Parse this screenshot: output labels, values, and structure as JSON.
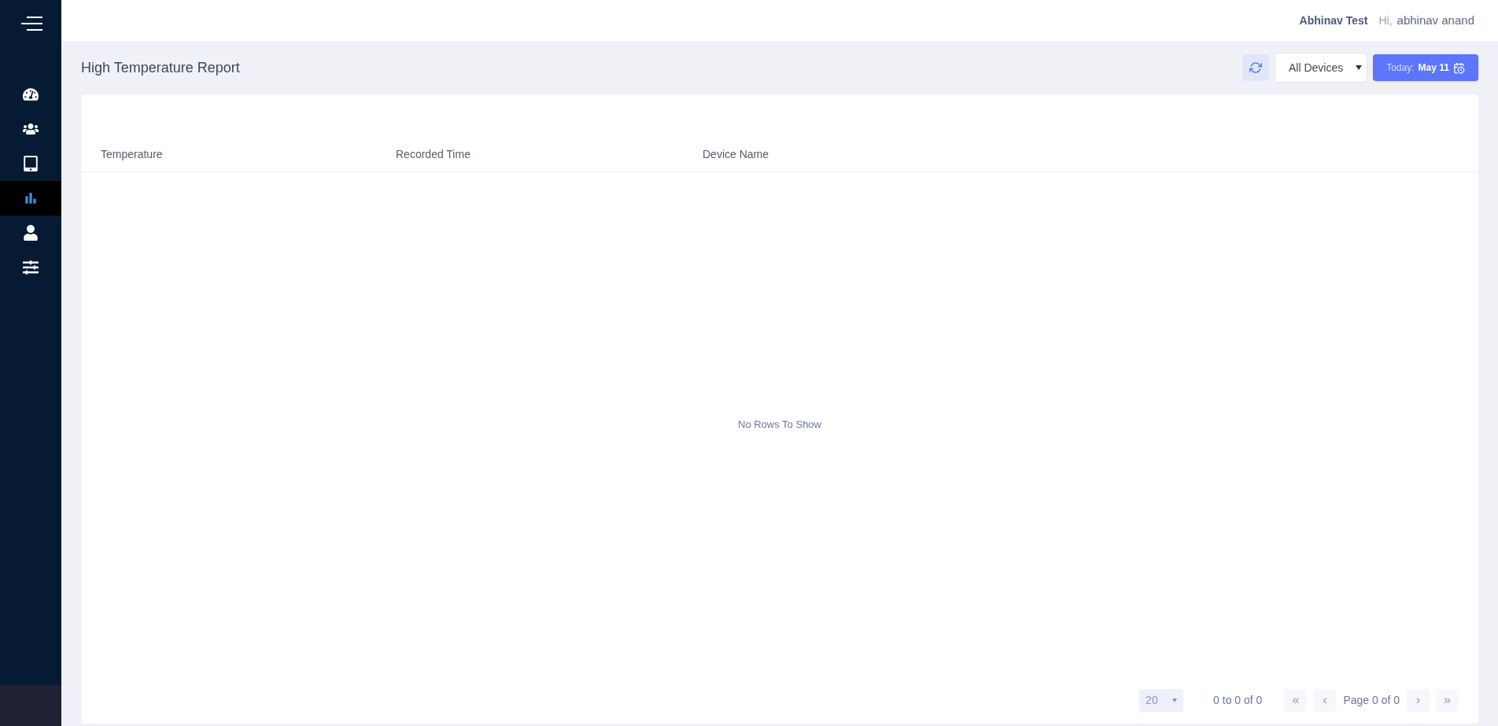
{
  "sidebar": {
    "items": [
      {
        "kind": "dashboard",
        "selected": false
      },
      {
        "kind": "users",
        "selected": false
      },
      {
        "kind": "devices",
        "selected": false
      },
      {
        "kind": "reports",
        "selected": true
      },
      {
        "kind": "profile",
        "selected": false
      },
      {
        "kind": "settings",
        "selected": false
      }
    ]
  },
  "header": {
    "account": "Abhinav Test",
    "greeting": "Hi,",
    "user": "abhinav anand"
  },
  "page": {
    "title": "High Temperature Report",
    "device_filter": "All Devices",
    "date_label": "Today:",
    "date_value": "May 11"
  },
  "table": {
    "columns": [
      "Temperature",
      "Recorded Time",
      "Device Name"
    ],
    "empty_message": "No Rows To Show"
  },
  "pagination": {
    "page_size": "20",
    "range": "0 to 0 of 0",
    "page_info": "Page 0 of 0",
    "buttons": [
      {
        "kind": "first",
        "label": "«",
        "disabled": true
      },
      {
        "kind": "prev",
        "label": "‹",
        "disabled": true
      },
      {
        "kind": "info"
      },
      {
        "kind": "next",
        "label": "›",
        "disabled": true
      },
      {
        "kind": "last",
        "label": "»",
        "disabled": true
      }
    ]
  }
}
